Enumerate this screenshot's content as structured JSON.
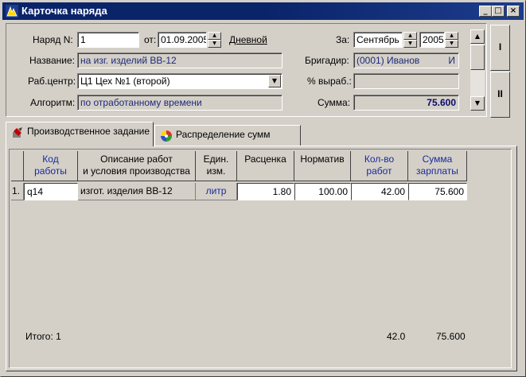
{
  "window": {
    "title": "Карточка наряда",
    "min": "_",
    "max": "□",
    "close": "×"
  },
  "form": {
    "order_no_label": "Наряд N:",
    "order_no": "1",
    "from_label": "от:",
    "date": "01.09.2005",
    "day_link": "Дневной",
    "name_label": "Название:",
    "name_value": "на изг. изделий ВВ-12",
    "workcenter_label": "Раб.центр:",
    "workcenter_value": "Ц1 Цех №1 (второй)",
    "algorithm_label": "Алгоритм:",
    "algorithm_value": "по отработанному времени",
    "period_label": "За:",
    "month": "Сентябрь",
    "year": "2005",
    "foreman_label": "Бригадир:",
    "foreman_value": "(0001) Иванов",
    "foreman_suffix": "И",
    "output_pct_label": "% выраб.:",
    "output_pct_value": "",
    "sum_label": "Сумма:",
    "sum_value": "75.600"
  },
  "side_buttons": {
    "first": "I",
    "second": "II"
  },
  "tabs": [
    {
      "label": "Производственное задание",
      "icon": "task-icon"
    },
    {
      "label": "Распределение сумм",
      "icon": "color-wheel-icon"
    }
  ],
  "grid": {
    "headers": [
      {
        "l1": "Код",
        "l2": "работы"
      },
      {
        "l1": "Описание работ",
        "l2": "и условия производства"
      },
      {
        "l1": "Един.",
        "l2": "изм."
      },
      {
        "l1": "Расценка",
        "l2": ""
      },
      {
        "l1": "Норматив",
        "l2": ""
      },
      {
        "l1": "Кол-во",
        "l2": "работ"
      },
      {
        "l1": "Сумма",
        "l2": "зарплаты"
      }
    ],
    "rows": [
      {
        "num": "1.",
        "code": "q14",
        "desc": "изгот. изделия  ВВ-12",
        "unit": "литр",
        "rate": "1.80",
        "norm": "100.00",
        "qty": "42.00",
        "sum": "75.600"
      }
    ],
    "footer": {
      "total_label": "Итого: 1",
      "qty_total": "42.0",
      "sum_total": "75.600"
    }
  },
  "colors": {
    "title_bar": "#0a246a",
    "face": "#d4d0c8",
    "accent_text": "#1c2a9a"
  }
}
